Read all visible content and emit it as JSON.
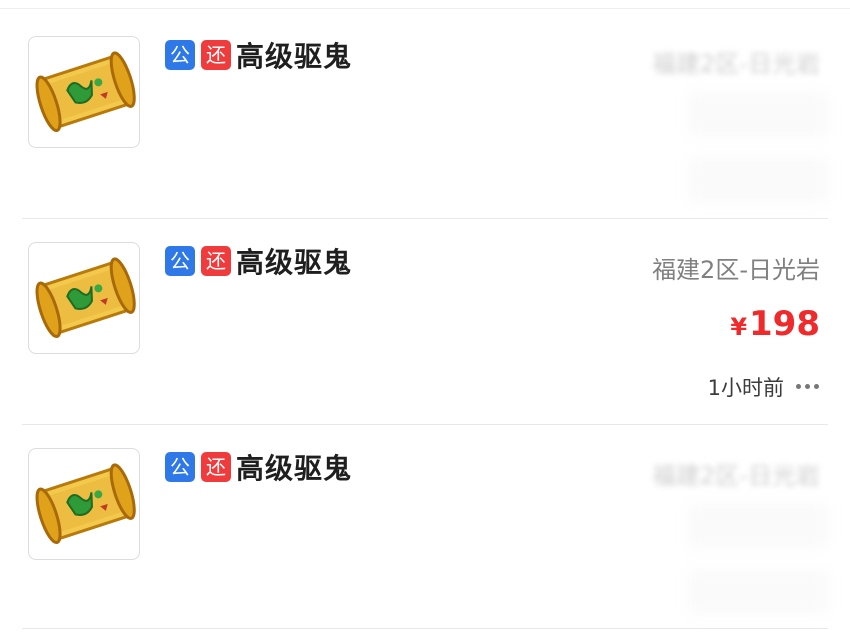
{
  "listings": [
    {
      "tag_public": "公",
      "tag_return": "还",
      "title": "高级驱鬼",
      "server": "福建2区-日光岩",
      "server_obscured": true
    },
    {
      "tag_public": "公",
      "tag_return": "还",
      "title": "高级驱鬼",
      "server": "福建2区-日光岩",
      "server_obscured": false,
      "price_symbol": "¥",
      "price": "198",
      "time": "1小时前"
    },
    {
      "tag_public": "公",
      "tag_return": "还",
      "title": "高级驱鬼",
      "server": "福建2区-日光岩",
      "server_obscured": true
    }
  ],
  "icons": {
    "item_image": "scroll-icon",
    "more": "more-icon"
  },
  "colors": {
    "tag_public": "#2f78e8",
    "tag_return": "#ef3b3b",
    "price": "#f0292b"
  }
}
